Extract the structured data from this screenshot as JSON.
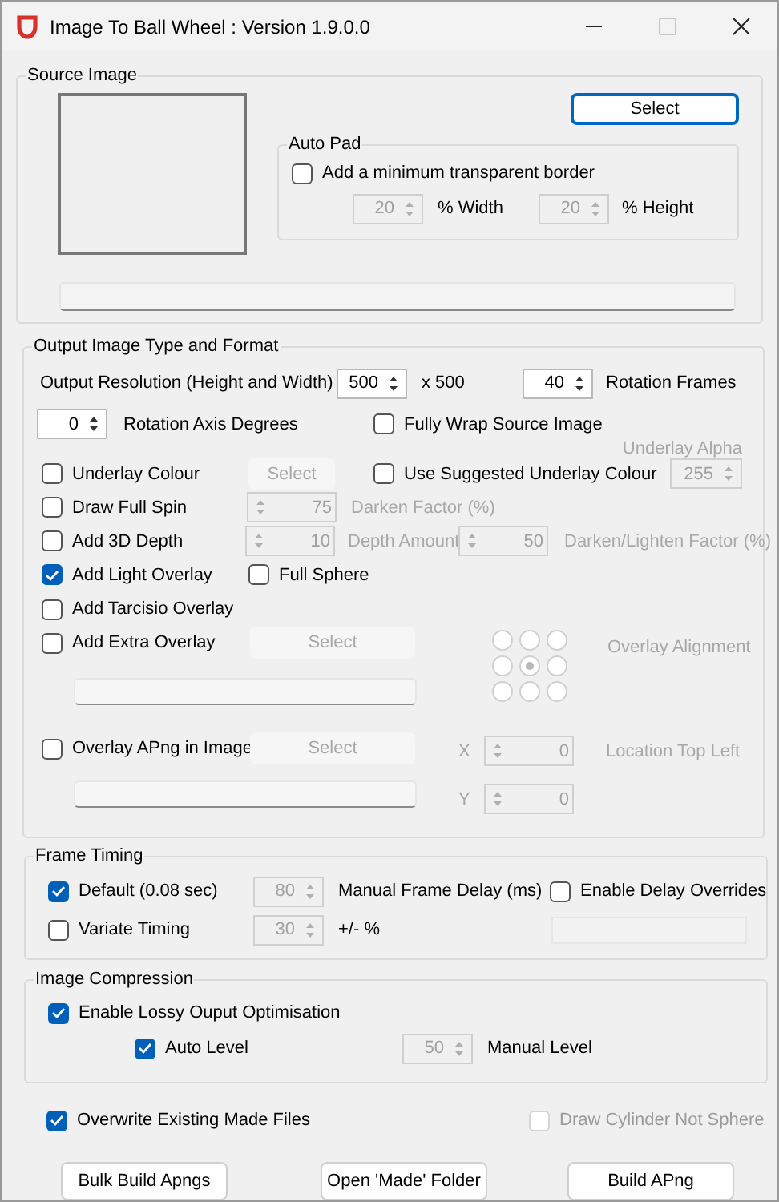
{
  "window": {
    "title": "Image To Ball Wheel : Version 1.9.0.0",
    "maximize_disabled": true
  },
  "source_image": {
    "legend": "Source Image",
    "select_button": {
      "label": "Select",
      "disabled": false
    },
    "auto_pad": {
      "legend": "Auto Pad",
      "border": {
        "label": "Add a minimum transparent border",
        "checked": false
      },
      "width": {
        "value": "20",
        "label": "% Width",
        "disabled": true
      },
      "height": {
        "value": "20",
        "label": "% Height",
        "disabled": true
      }
    },
    "progress": {
      "level": 0
    }
  },
  "output": {
    "legend": "Output Image Type and Format",
    "resolution": {
      "label": "Output Resolution (Height and Width)",
      "value": "500",
      "disabled": false,
      "suffix": "x 500"
    },
    "frames": {
      "value": "40",
      "label": "Rotation Frames",
      "disabled": false
    },
    "axis": {
      "value": "0",
      "label": "Rotation Axis Degrees",
      "disabled": false
    },
    "fully_wrap": {
      "label": "Fully Wrap Source Image",
      "checked": false
    },
    "underlay_alpha": {
      "label": "Underlay Alpha",
      "value": "255",
      "disabled": true,
      "dim": true
    },
    "underlay_colour": {
      "label": "Underlay Colour",
      "checked": false
    },
    "underlay_select": {
      "label": "Select",
      "disabled": true
    },
    "suggested_underlay": {
      "label": "Use Suggested Underlay Colour",
      "checked": false
    },
    "full_spin": {
      "label": "Draw Full Spin",
      "checked": false
    },
    "darken": {
      "value": "75",
      "label": "Darken Factor (%)",
      "disabled": true,
      "dim": true
    },
    "depth_3d": {
      "label": "Add 3D Depth",
      "checked": false
    },
    "depth_amount": {
      "value": "10",
      "label": "Depth Amount",
      "disabled": true,
      "dim": true
    },
    "darken_lighten": {
      "value": "50",
      "label": "Darken/Lighten Factor (%)",
      "disabled": true,
      "dim": true
    },
    "light_overlay": {
      "label": "Add Light Overlay",
      "checked": true
    },
    "full_sphere": {
      "label": "Full Sphere",
      "checked": false
    },
    "tarcisio_overlay": {
      "label": "Add Tarcisio Overlay",
      "checked": false
    },
    "extra_overlay": {
      "label": "Add Extra Overlay",
      "checked": false
    },
    "extra_select": {
      "label": "Select",
      "disabled": true
    },
    "alignment": {
      "label": "Overlay Alignment",
      "disabled": true,
      "options": [
        {
          "selected": false
        },
        {
          "selected": false
        },
        {
          "selected": false
        },
        {
          "selected": false
        },
        {
          "selected": true
        },
        {
          "selected": false
        },
        {
          "selected": false
        },
        {
          "selected": false
        },
        {
          "selected": false
        }
      ]
    },
    "apng_overlay": {
      "label": "Overlay APng in Image",
      "checked": false
    },
    "apng_select": {
      "label": "Select",
      "disabled": true
    },
    "location": {
      "label": "Location Top Left",
      "disabled": true,
      "x": {
        "label": "X",
        "value": "0"
      },
      "y": {
        "label": "Y",
        "value": "0"
      }
    }
  },
  "frame_timing": {
    "legend": "Frame Timing",
    "default": {
      "label": "Default (0.08 sec)",
      "checked": true
    },
    "delay": {
      "value": "80",
      "label": "Manual Frame Delay (ms)",
      "disabled": true
    },
    "overrides": {
      "label": "Enable Delay Overrides",
      "checked": false
    },
    "variate": {
      "label": "Variate Timing",
      "checked": false
    },
    "variance": {
      "value": "30",
      "label": "+/- %",
      "disabled": true
    }
  },
  "compression": {
    "legend": "Image Compression",
    "lossy": {
      "label": "Enable Lossy Ouput Optimisation",
      "checked": true
    },
    "auto_level": {
      "label": "Auto Level",
      "checked": true
    },
    "manual": {
      "value": "50",
      "label": "Manual Level",
      "disabled": true
    }
  },
  "overwrite": {
    "label": "Overwrite Existing Made Files",
    "checked": true
  },
  "cylinder": {
    "label": "Draw Cylinder Not Sphere",
    "checked": false,
    "disabled": true
  },
  "buttons": [
    {
      "label": "Bulk Build Apngs"
    },
    {
      "label": "Open 'Made' Folder"
    },
    {
      "label": "Build APng"
    }
  ]
}
